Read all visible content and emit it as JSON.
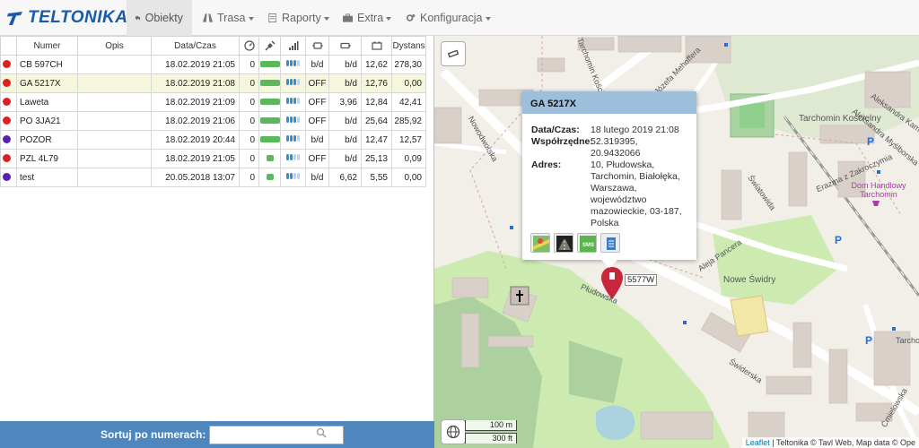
{
  "nav": {
    "brand": "TELTONIKA",
    "items": [
      {
        "label": "Obiekty"
      },
      {
        "label": "Trasa"
      },
      {
        "label": "Raporty"
      },
      {
        "label": "Extra"
      },
      {
        "label": "Konfiguracja"
      }
    ]
  },
  "table": {
    "headers": {
      "numer": "Numer",
      "opis": "Opis",
      "data": "Data/Czas",
      "dystans": "Dystans"
    },
    "header_icons": [
      "speedometer-icon",
      "satellite-icon",
      "gsm-signal-icon",
      "engine-icon",
      "battery-icon",
      "car-battery-icon"
    ],
    "rows": [
      {
        "status_color": "#e02020",
        "numer": "CB 597CH",
        "opis": "",
        "data": "18.02.2019 21:05",
        "speed": "0",
        "gps": 3,
        "gsm": 4,
        "ign": "b/d",
        "v1": "b/d",
        "v2": "12,62",
        "dist": "278,30",
        "bar_short": false
      },
      {
        "status_color": "#e02020",
        "numer": "GA 5217X",
        "opis": "",
        "data": "18.02.2019 21:08",
        "speed": "0",
        "gps": 3,
        "gsm": 4,
        "ign": "OFF",
        "v1": "b/d",
        "v2": "12,76",
        "dist": "0,00",
        "bar_short": false
      },
      {
        "status_color": "#e02020",
        "numer": "Laweta",
        "opis": "",
        "data": "18.02.2019 21:09",
        "speed": "0",
        "gps": 3,
        "gsm": 4,
        "ign": "OFF",
        "v1": "3,96",
        "v2": "12,84",
        "dist": "42,41",
        "bar_short": false
      },
      {
        "status_color": "#e02020",
        "numer": "PO 3JA21",
        "opis": "",
        "data": "18.02.2019 21:06",
        "speed": "0",
        "gps": 3,
        "gsm": 4,
        "ign": "OFF",
        "v1": "b/d",
        "v2": "25,64",
        "dist": "285,92",
        "bar_short": false
      },
      {
        "status_color": "#5a1fb0",
        "numer": "POZOR",
        "opis": "",
        "data": "18.02.2019 20:44",
        "speed": "0",
        "gps": 3,
        "gsm": 4,
        "ign": "b/d",
        "v1": "b/d",
        "v2": "12,47",
        "dist": "12,57",
        "bar_short": false
      },
      {
        "status_color": "#e02020",
        "numer": "PZL 4L79",
        "opis": "",
        "data": "18.02.2019 21:05",
        "speed": "0",
        "gps": 2,
        "gsm": 4,
        "ign": "OFF",
        "v1": "b/d",
        "v2": "25,13",
        "dist": "0,09",
        "bar_short": true
      },
      {
        "status_color": "#5a1fb0",
        "numer": "test",
        "opis": "",
        "data": "20.05.2018 13:07",
        "speed": "0",
        "gps": 2,
        "gsm": 4,
        "ign": "b/d",
        "v1": "6,62",
        "v2": "5,55",
        "dist": "0,00",
        "bar_short": true
      }
    ]
  },
  "sort": {
    "label": "Sortuj po numerach:",
    "value": ""
  },
  "popup": {
    "title": "GA 5217X",
    "rows": [
      {
        "k": "Data/Czas:",
        "v": "18 lutego 2019 21:08"
      },
      {
        "k": "Współrzędne:",
        "v": "52.319395, 20.9432066"
      },
      {
        "k": "Adres:",
        "v": "10, Płudowska, Tarchomin, Białołęka, Warszawa, województwo mazowieckie, 03-187, Polska"
      }
    ],
    "actions": [
      "google-maps-icon",
      "street-view-icon",
      "sms-icon",
      "document-icon"
    ]
  },
  "map": {
    "marker_label": "5577W",
    "labels": {
      "tarchomin_koscielny": "Tarchomin Kościelny",
      "dom_handlowy": "Dom Handlowy Tarchomin",
      "nowe_swidry": "Nowe Świdry",
      "pludowska": "Płudowska",
      "swiderska": "Świderska",
      "nowodworska": "Nowodworska",
      "swiatowida": "Światowida",
      "pancera": "Aleja Pancera",
      "myslborska": "Aleksandra Myślborska",
      "kaminskiego": "Aleksandra Kamińs",
      "tarchomin_kosc_top": "Tarchomin Kościelny",
      "mehoffera": "Józefa Mehoffera",
      "erazma": "Erazma z Zakroczymia",
      "cmielowska": "Ćmielowska",
      "tarch_right": "Tarcho"
    },
    "scale_m": "100 m",
    "scale_ft": "300 ft",
    "attribution_leaflet": "Leaflet",
    "attribution_rest": "| Teltonika © Tavl Web, Map data © Ope"
  }
}
